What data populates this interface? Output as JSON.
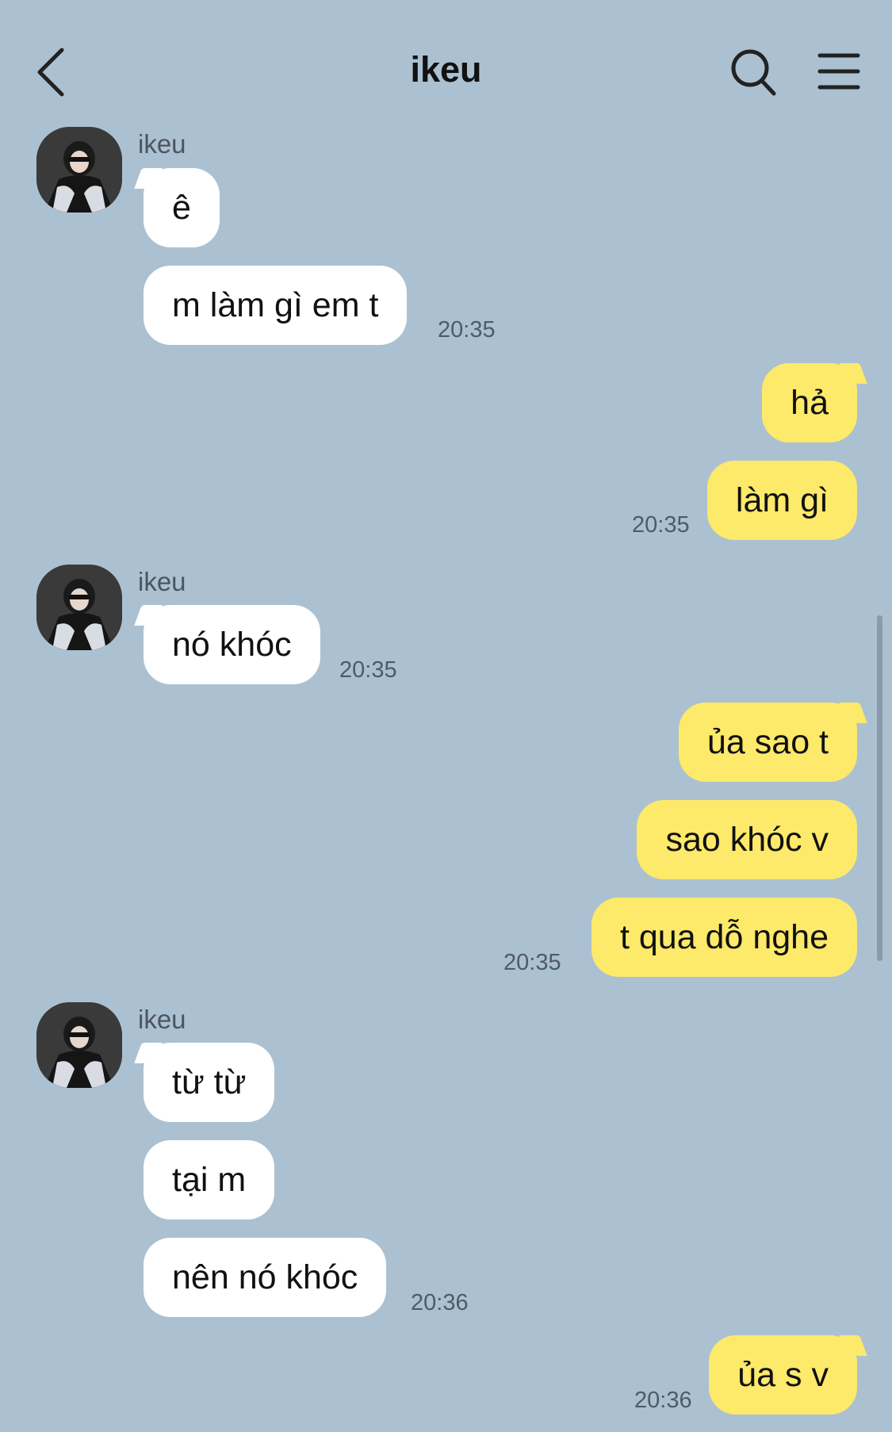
{
  "header": {
    "title": "ikeu"
  },
  "contact": {
    "name": "ikeu"
  },
  "messages": {
    "m1": "ê",
    "m2": "m làm gì em t",
    "t1": "20:35",
    "m3": "hả",
    "m4": "làm gì",
    "t2": "20:35",
    "m5": "nó khóc",
    "t3": "20:35",
    "m6": "ủa sao t",
    "m7": "sao khóc v",
    "m8": "t qua dỗ nghe",
    "t4": "20:35",
    "m9": "từ từ",
    "m10": "tại m",
    "m11": "nên nó khóc",
    "t5": "20:36",
    "m12": "ủa s v",
    "t6": "20:36"
  },
  "colors": {
    "background": "#abc1d1",
    "incoming_bubble": "#ffffff",
    "outgoing_bubble": "#fde96a"
  },
  "icons": [
    "back-arrow-icon",
    "search-icon",
    "menu-icon",
    "avatar"
  ]
}
